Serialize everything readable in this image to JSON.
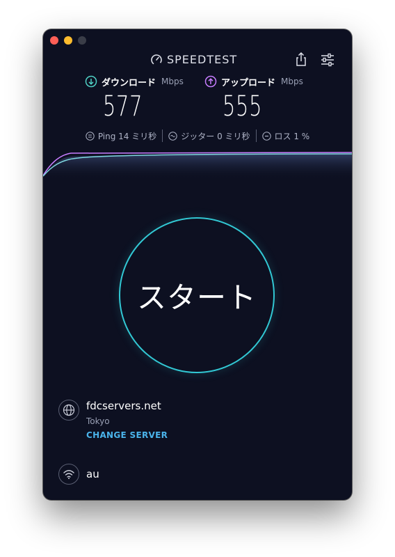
{
  "app": {
    "brand": "SPEEDTEST"
  },
  "download": {
    "label": "ダウンロード",
    "unit": "Mbps",
    "value": "577"
  },
  "upload": {
    "label": "アップロード",
    "unit": "Mbps",
    "value": "555"
  },
  "stats": {
    "ping": "Ping 14 ミリ秒",
    "jitter": "ジッター 0 ミリ秒",
    "loss": "ロス 1 %"
  },
  "start": {
    "label": "スタート"
  },
  "server": {
    "name": "fdcservers.net",
    "location": "Tokyo",
    "change_label": "CHANGE SERVER"
  },
  "isp": {
    "name": "au"
  },
  "colors": {
    "background": "#0d1021",
    "accent_teal": "#32c8d4",
    "download_accent": "#4fd1c5",
    "upload_accent": "#c77dff",
    "link": "#4ab3ea"
  }
}
